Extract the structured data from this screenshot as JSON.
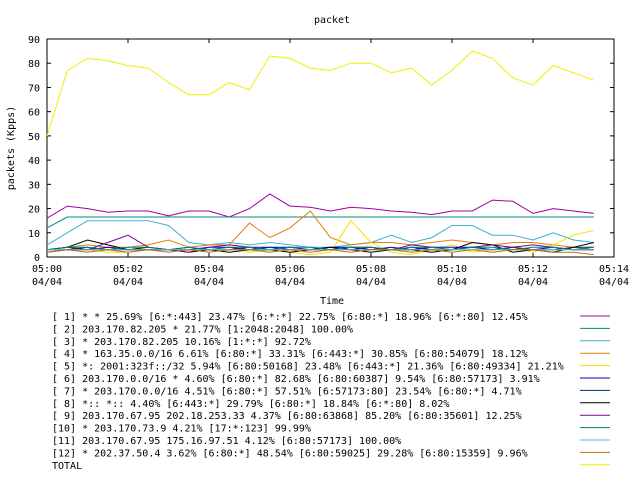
{
  "chart_data": {
    "type": "line",
    "title": "packet",
    "xlabel": "Time",
    "ylabel": "packets (Kpps)",
    "ylim": [
      0,
      90
    ],
    "yticks": [
      "0",
      "10",
      "20",
      "30",
      "40",
      "50",
      "60",
      "70",
      "80",
      "90"
    ],
    "xticks": [
      {
        "time": "05:00",
        "date": "04/04"
      },
      {
        "time": "05:02",
        "date": "04/04"
      },
      {
        "time": "05:04",
        "date": "04/04"
      },
      {
        "time": "05:06",
        "date": "04/04"
      },
      {
        "time": "05:08",
        "date": "04/04"
      },
      {
        "time": "05:10",
        "date": "04/04"
      },
      {
        "time": "05:12",
        "date": "04/04"
      },
      {
        "time": "05:14",
        "date": "04/04"
      }
    ],
    "x": [
      "05:00:00",
      "05:00:30",
      "05:01:00",
      "05:01:30",
      "05:02:00",
      "05:02:30",
      "05:03:00",
      "05:03:30",
      "05:04:00",
      "05:04:30",
      "05:05:00",
      "05:05:30",
      "05:06:00",
      "05:06:30",
      "05:07:00",
      "05:07:30",
      "05:08:00",
      "05:08:30",
      "05:09:00",
      "05:09:30",
      "05:10:00",
      "05:10:30",
      "05:11:00",
      "05:11:30",
      "05:12:00",
      "05:12:30",
      "05:13:00",
      "05:13:30"
    ],
    "grid": false,
    "legend_position": "bottom",
    "series": [
      {
        "name": "[ 1] * * 25.69%  [6:*:443] 23.47% [6:*:*] 22.75% [6:80:*] 18.96% [6:*:80] 12.45%",
        "color": "#a000a0",
        "values": [
          16,
          21,
          20,
          18.5,
          19,
          19,
          17,
          19,
          19,
          16.5,
          20,
          26,
          21,
          20.5,
          19,
          20.5,
          20,
          19,
          18.5,
          17.5,
          19,
          19,
          23.5,
          23,
          18,
          20,
          19,
          18
        ]
      },
      {
        "name": "[ 2] 203.170.82.205 * 21.77%  [1:2048:2048] 100.00%",
        "color": "#008b80",
        "values": [
          12,
          16.5,
          16.5,
          16.5,
          16.5,
          16.5,
          16.5,
          16.5,
          16.5,
          16.5,
          16.5,
          16.5,
          16.5,
          16.5,
          16.5,
          16.5,
          16.5,
          16.5,
          16.5,
          16.5,
          16.5,
          16.5,
          16.5,
          16.5,
          16.5,
          16.5,
          16.5,
          16.5
        ]
      },
      {
        "name": "[ 3] * 203.170.82.205 10.16%  [1:*:*] 92.72%",
        "color": "#40b0d0",
        "values": [
          5,
          10,
          15,
          15,
          15,
          15,
          13,
          6,
          5,
          6,
          5,
          6,
          5,
          4,
          4,
          5,
          6,
          9,
          6,
          8,
          13,
          13,
          9,
          9,
          7,
          10,
          7,
          6
        ]
      },
      {
        "name": "[ 4] * 163.35.0.0/16 6.61%  [6:80:*] 33.31% [6:443:*] 30.85% [6:80:54079] 18.12%",
        "color": "#e08000",
        "values": [
          3,
          4,
          5,
          4,
          4,
          5,
          7,
          4,
          5,
          5,
          14,
          8,
          12,
          19,
          8,
          5,
          6,
          6,
          5,
          6,
          7,
          6,
          5,
          6,
          6,
          5,
          4,
          3
        ]
      },
      {
        "name": "[ 5] *: 2001:323f::/32 5.94%  [6:80:50168] 23.48% [6:443:*] 21.36% [6:80:49334] 21.21%",
        "color": "#f0e000",
        "values": [
          2,
          3,
          3,
          2,
          2,
          3,
          3,
          4,
          3,
          4,
          2,
          3,
          2,
          1,
          2,
          15,
          6,
          2,
          1,
          3,
          5,
          2,
          3,
          4,
          2,
          5,
          9,
          11
        ]
      },
      {
        "name": "[ 6] 203.170.0.0/16 * 4.60%  [6:80:*] 82.68% [6:80:60387] 9.54% [6:80:57173] 3.91%",
        "color": "#0000c0",
        "values": [
          3,
          4,
          3,
          4,
          3,
          3,
          3,
          3,
          4,
          4,
          3,
          4,
          4,
          3,
          4,
          4,
          3,
          4,
          3,
          4,
          4,
          4,
          3,
          4,
          3,
          4,
          3,
          3
        ]
      },
      {
        "name": "[ 7] * 203.170.0.0/16 4.51%  [6:80:*] 57.51% [6:57173:80] 23.54% [6:80:*] 4.71%",
        "color": "#003070",
        "values": [
          3,
          3,
          4,
          3,
          3,
          3,
          3,
          4,
          3,
          3,
          4,
          4,
          3,
          3,
          4,
          3,
          4,
          3,
          4,
          3,
          3,
          4,
          3,
          4,
          3,
          3,
          4,
          4
        ]
      },
      {
        "name": "[ 8] *:: *:: 4.40%  [6:443:*] 29.79% [6:80:*] 18.84% [6:*:80] 8.02%",
        "color": "#000000",
        "values": [
          3,
          4,
          7,
          5,
          3,
          4,
          3,
          2,
          3,
          2,
          3,
          3,
          2,
          3,
          4,
          3,
          2,
          3,
          3,
          2,
          3,
          6,
          5,
          2,
          3,
          2,
          4,
          6
        ]
      },
      {
        "name": "[ 9] 203.170.67.95 202.18.253.33 4.37%  [6:80:63868] 85.20% [6:80:35601] 12.25%",
        "color": "#8000a0",
        "values": [
          2,
          3,
          3,
          6,
          9,
          4,
          3,
          2,
          4,
          5,
          4,
          3,
          4,
          3,
          3,
          4,
          4,
          3,
          5,
          4,
          3,
          4,
          5,
          4,
          5,
          4,
          3,
          3
        ]
      },
      {
        "name": "[10] * 203.170.73.9 4.21%  [17:*:123] 99.99%",
        "color": "#008070",
        "values": [
          3,
          4,
          4,
          3,
          4,
          4,
          3,
          4,
          3,
          4,
          4,
          3,
          4,
          4,
          3,
          4,
          4,
          3,
          4,
          4,
          3,
          4,
          4,
          3,
          4,
          4,
          3,
          4
        ]
      },
      {
        "name": "[11] 203.170.67.95 175.16.97.51 4.12%  [6:80:57173] 100.00%",
        "color": "#60b8d8",
        "values": [
          3,
          3,
          3,
          3,
          3,
          3,
          3,
          3,
          3,
          3,
          3,
          3,
          3,
          3,
          3,
          3,
          3,
          3,
          3,
          3,
          3,
          3,
          3,
          3,
          3,
          3,
          3,
          3
        ]
      },
      {
        "name": "[12] * 202.37.50.4 3.62%  [6:80:*] 48.54% [6:80:59025] 29.28% [6:80:15359] 9.96%",
        "color": "#c07000",
        "values": [
          2,
          3,
          2,
          3,
          2,
          3,
          2,
          3,
          2,
          3,
          3,
          2,
          3,
          2,
          3,
          2,
          3,
          3,
          2,
          3,
          2,
          3,
          2,
          3,
          3,
          2,
          2,
          1
        ]
      },
      {
        "name": "TOTAL",
        "color": "#f0f000",
        "values": [
          50,
          77,
          82,
          81,
          79,
          78,
          72,
          67,
          67,
          72,
          69,
          83,
          82,
          78,
          77,
          80,
          80,
          76,
          78,
          71,
          77,
          85,
          82,
          74,
          71,
          79,
          76,
          73
        ]
      }
    ]
  }
}
